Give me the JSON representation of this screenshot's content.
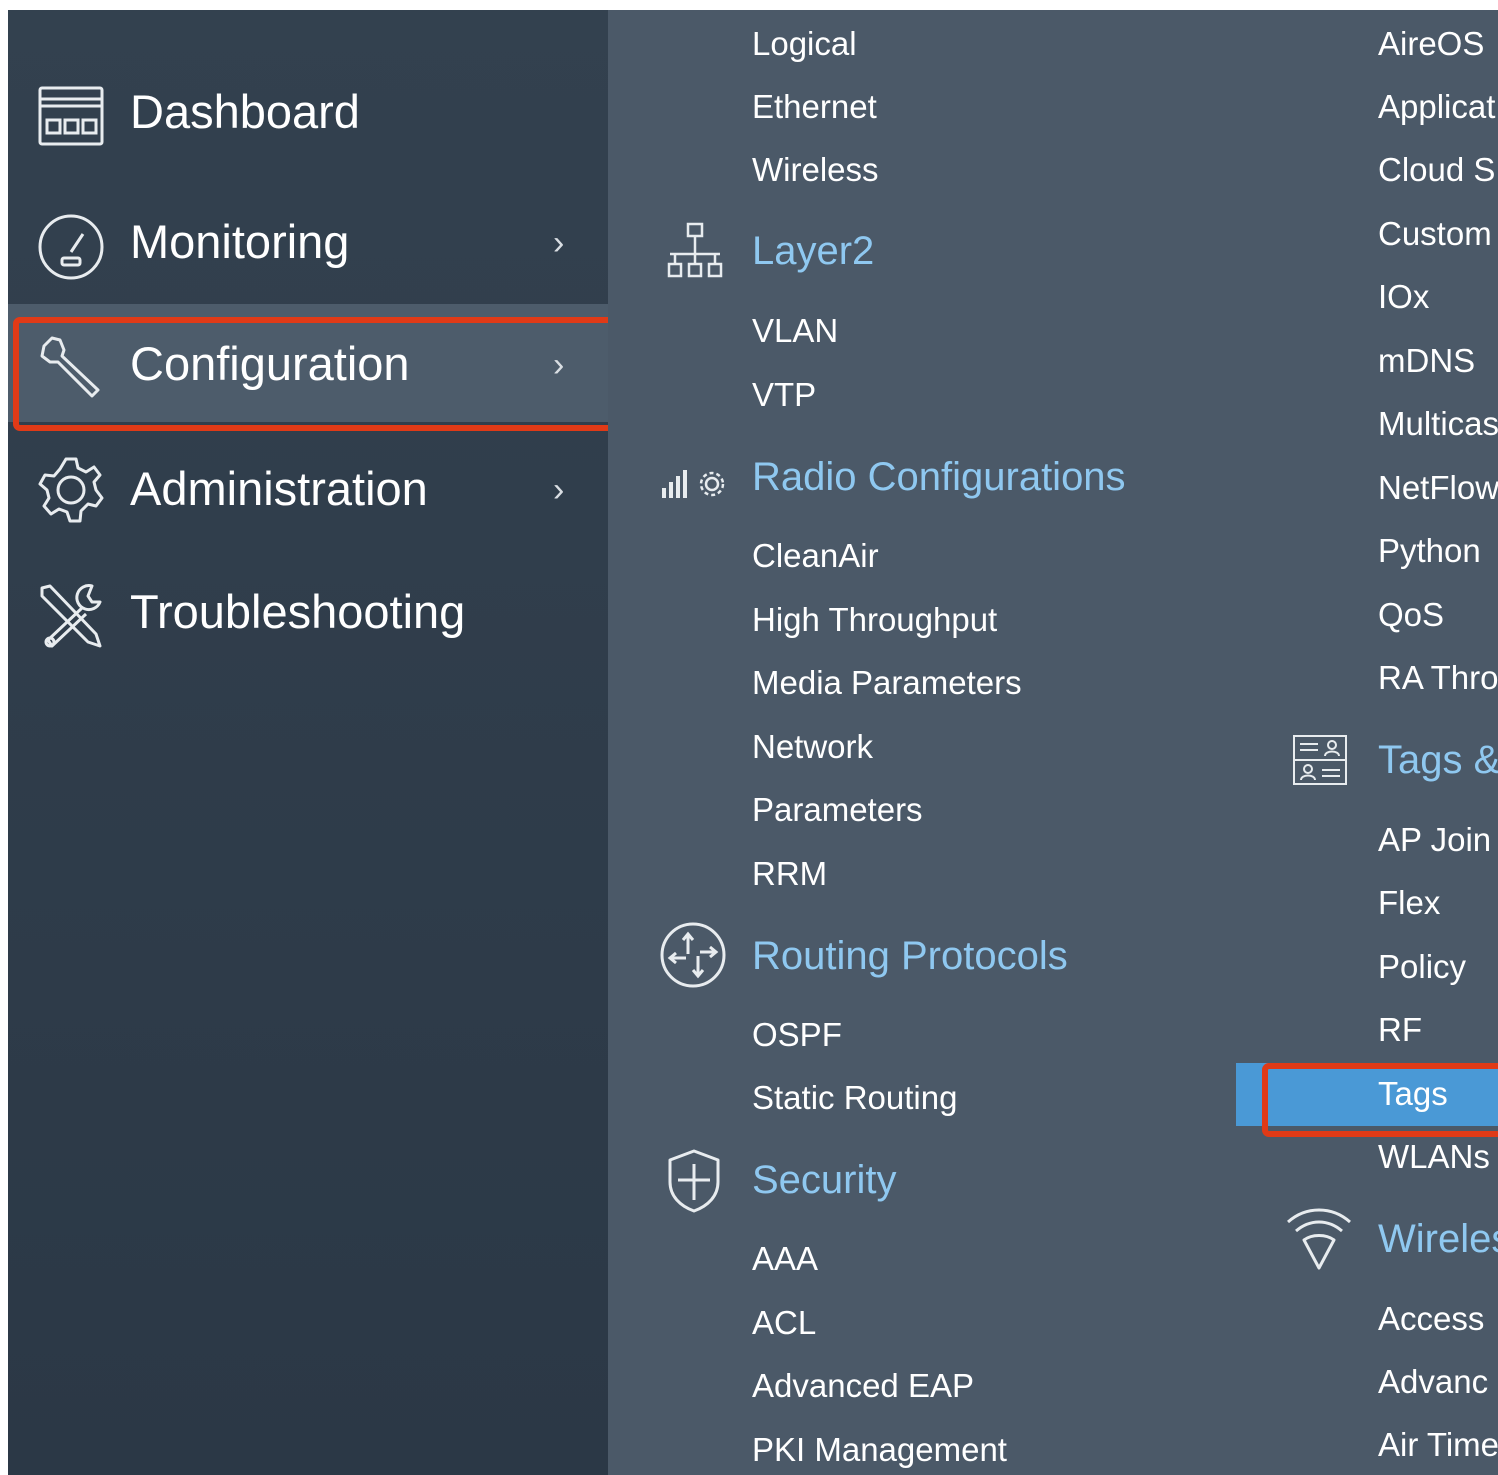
{
  "sidebar": {
    "items": [
      {
        "label": "Dashboard",
        "icon": "dashboard-icon",
        "has_chevron": false,
        "active": false
      },
      {
        "label": "Monitoring",
        "icon": "speedometer-icon",
        "has_chevron": true,
        "active": false
      },
      {
        "label": "Configuration",
        "icon": "wrench-icon",
        "has_chevron": true,
        "active": true
      },
      {
        "label": "Administration",
        "icon": "gear-icon",
        "has_chevron": true,
        "active": false
      },
      {
        "label": "Troubleshooting",
        "icon": "tools-icon",
        "has_chevron": false,
        "active": false
      }
    ],
    "chevron": "›"
  },
  "menu": {
    "col1": {
      "interface_items": [
        "Logical",
        "Ethernet",
        "Wireless"
      ],
      "layer2": {
        "title": "Layer2",
        "icon": "network-topology-icon",
        "items": [
          "VLAN",
          "VTP"
        ]
      },
      "radio": {
        "title": "Radio Configurations",
        "icon": "radio-signal-icon",
        "items": [
          "CleanAir",
          "High Throughput",
          "Media Parameters",
          "Network",
          "Parameters",
          "RRM"
        ]
      },
      "routing": {
        "title": "Routing Protocols",
        "icon": "routing-icon",
        "items": [
          "OSPF",
          "Static Routing"
        ]
      },
      "security": {
        "title": "Security",
        "icon": "shield-icon",
        "items": [
          "AAA",
          "ACL",
          "Advanced EAP",
          "PKI Management"
        ]
      }
    },
    "col2": {
      "services_items": [
        "AireOS",
        "Applicat",
        "Cloud S",
        "Custom",
        "IOx",
        "mDNS",
        "Multicas",
        "NetFlow",
        "Python",
        "QoS",
        "RA Thro"
      ],
      "tags": {
        "title": "Tags &",
        "icon": "tags-profiles-icon",
        "items": [
          "AP Join",
          "Flex",
          "Policy",
          "RF",
          "Tags",
          "WLANs"
        ],
        "selected": "Tags"
      },
      "wireless": {
        "title": "Wireles",
        "icon": "wifi-icon",
        "items": [
          "Access",
          "Advanc",
          "Air Time"
        ]
      }
    }
  },
  "colors": {
    "sidebar_bg": "#2f3d4b",
    "panel_bg": "#4b5968",
    "section_title": "#8fc8f0",
    "selected_bg": "#4a99d6",
    "highlight": "#e03a17"
  }
}
